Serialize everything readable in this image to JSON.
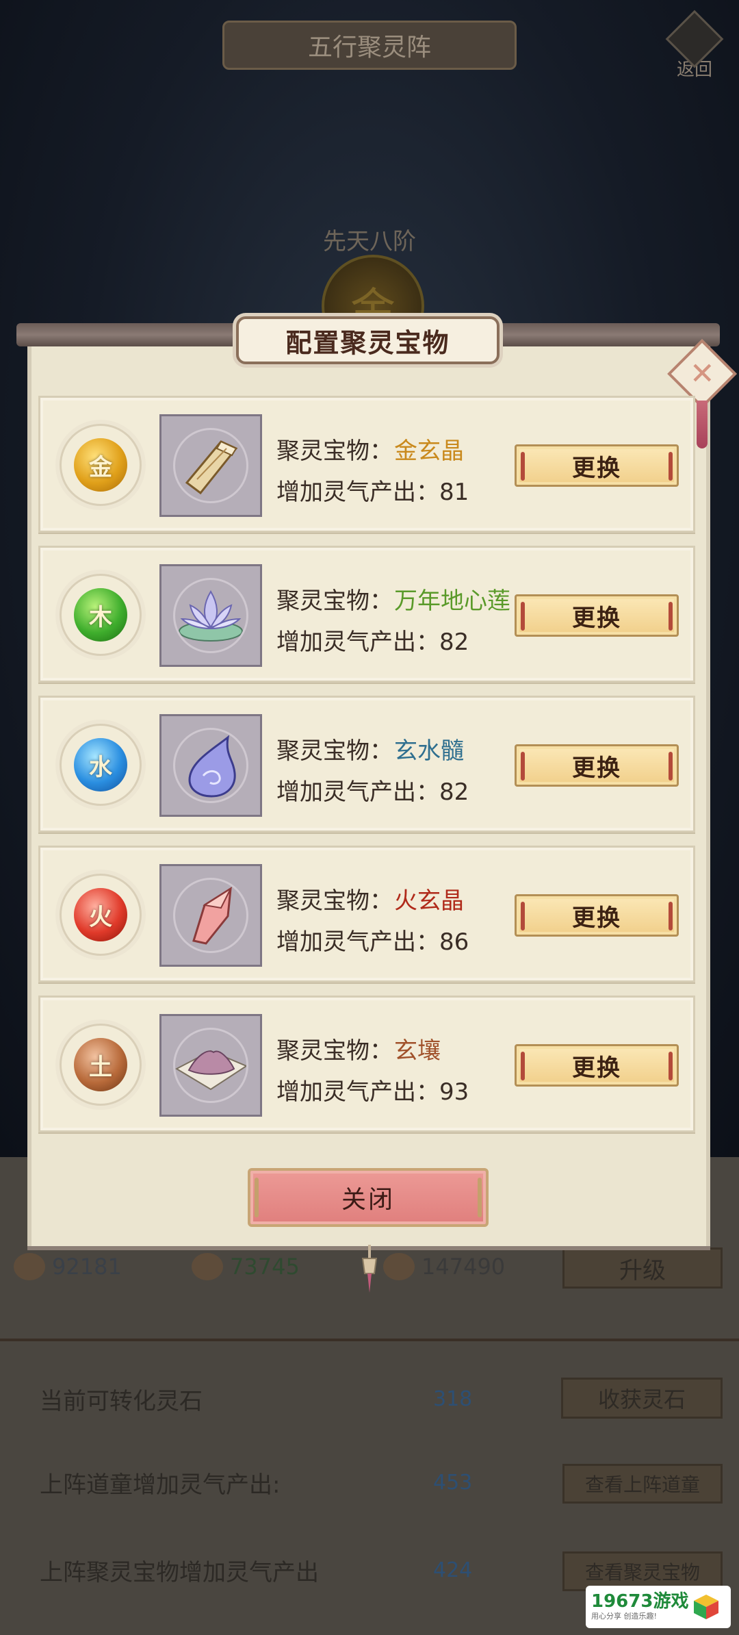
{
  "background": {
    "title": "五行聚灵阵",
    "back_label": "返回",
    "rank": "先天八阶",
    "orb_glyph": "金",
    "resources": [
      "92181",
      "73745",
      "147490"
    ],
    "upgrade_label": "升级",
    "rows": [
      {
        "label": "当前可转化灵石",
        "value": "318",
        "button": "收获灵石"
      },
      {
        "label": "上阵道童增加灵气产出:",
        "value": "453",
        "button": "查看上阵道童"
      },
      {
        "label": "上阵聚灵宝物增加灵气产出",
        "value": "424",
        "button": "查看聚灵宝物"
      }
    ]
  },
  "modal": {
    "title": "配置聚灵宝物",
    "close_label": "关闭",
    "item_prefix": "聚灵宝物：",
    "output_prefix": "增加灵气产出：",
    "swap_label": "更换",
    "items": [
      {
        "element": "金",
        "name": "金玄晶",
        "output": "81",
        "name_color": "#c9891c",
        "orb_color": "#e0a01a",
        "icon": "gold-crystal-icon"
      },
      {
        "element": "木",
        "name": "万年地心莲",
        "output": "82",
        "name_color": "#5a9a2a",
        "orb_color": "#3fae2d",
        "icon": "lotus-icon"
      },
      {
        "element": "水",
        "name": "玄水髓",
        "output": "82",
        "name_color": "#2f6f8f",
        "orb_color": "#2a8ee0",
        "icon": "water-drop-icon"
      },
      {
        "element": "火",
        "name": "火玄晶",
        "output": "86",
        "name_color": "#b02a1a",
        "orb_color": "#e03a2a",
        "icon": "fire-crystal-icon"
      },
      {
        "element": "土",
        "name": "玄壤",
        "output": "93",
        "name_color": "#a0512a",
        "orb_color": "#b86a3a",
        "icon": "soil-icon"
      }
    ]
  },
  "watermark": {
    "main": "19673游戏",
    "sub": "用心分享 创造乐趣!"
  }
}
